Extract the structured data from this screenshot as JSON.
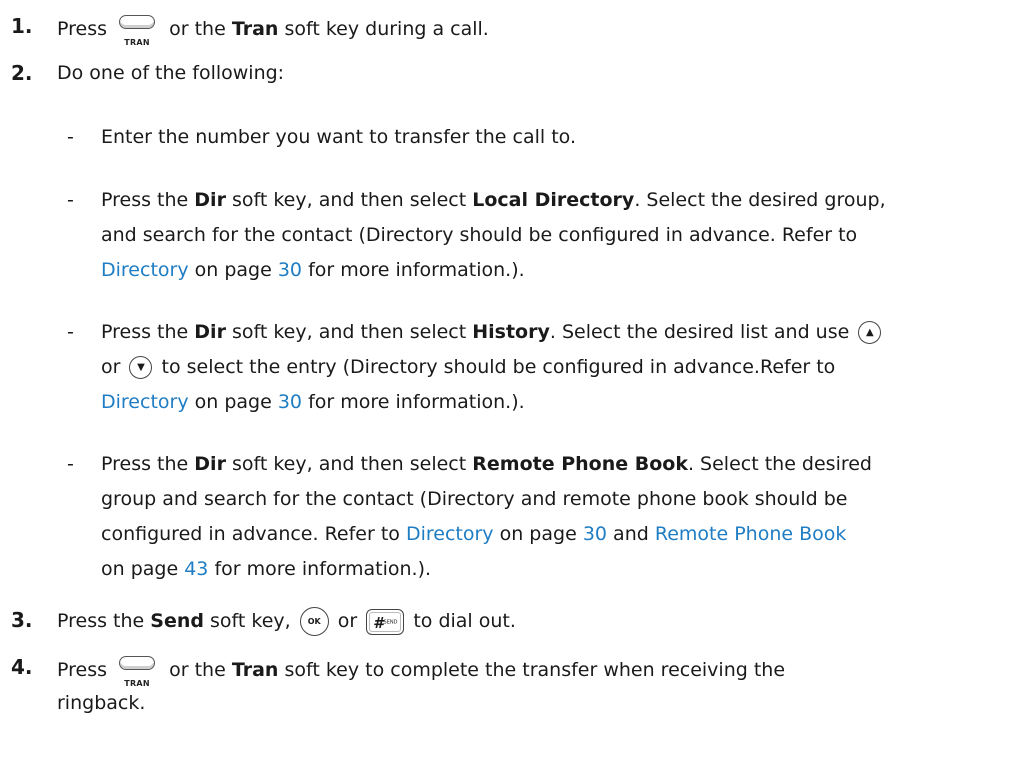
{
  "steps": [
    {
      "num": "1.",
      "press": "Press",
      "mid": "or the",
      "tran": "Tran",
      "end": "soft key during a call."
    },
    {
      "num": "2.",
      "text": "Do one of the following:"
    },
    {
      "num": "3.",
      "press": "Press the",
      "send": "Send",
      "mid": "soft key,",
      "or": "or",
      "end": "to dial out."
    },
    {
      "num": "4.",
      "press": "Press",
      "mid": "or the",
      "tran": "Tran",
      "end1": "soft key to complete the transfer when receiving the",
      "end2": "ringback."
    }
  ],
  "keys": {
    "tran_label": "TRAN",
    "ok_label": "OK",
    "send_hash": "#",
    "send_sub": "SEND",
    "up_icon": "up-arrow-key-icon",
    "down_icon": "down-arrow-key-icon"
  },
  "bullets": [
    {
      "dash": "-",
      "text": "Enter the number you want to transfer the call to."
    },
    {
      "dash": "-",
      "l1_a": "Press the",
      "l1_dir": "Dir",
      "l1_b": "soft key, and then select",
      "l1_sel": "Local Directory",
      "l1_c": ". Select the desired group,",
      "l2": "and search for the contact (Directory should be configured in advance. Refer to",
      "l3_link": "Directory",
      "l3_a": "on page",
      "l3_page": "30",
      "l3_b": "for more information.)."
    },
    {
      "dash": "-",
      "l1_a": "Press the",
      "l1_dir": "Dir",
      "l1_b": "soft key, and then select",
      "l1_sel": "History",
      "l1_c": ". Select the desired list and use",
      "l2_or": "or",
      "l2_b": "to select the entry (Directory should be configured in advance.Refer to",
      "l3_link": "Directory",
      "l3_a": "on page",
      "l3_page": "30",
      "l3_b": "for more information.)."
    },
    {
      "dash": "-",
      "l1_a": "Press the",
      "l1_dir": "Dir",
      "l1_b": "soft key, and then select",
      "l1_sel": "Remote Phone Book",
      "l1_c": ". Select the desired",
      "l2": "group and search for the contact (Directory and remote phone book should be",
      "l3_a": "configured in advance. Refer to",
      "l3_link1": "Directory",
      "l3_b": "on page",
      "l3_page1": "30",
      "l3_c": "and",
      "l3_link2": "Remote Phone Book",
      "l4_a": "on page",
      "l4_page": "43",
      "l4_b": "for more information.)."
    }
  ]
}
